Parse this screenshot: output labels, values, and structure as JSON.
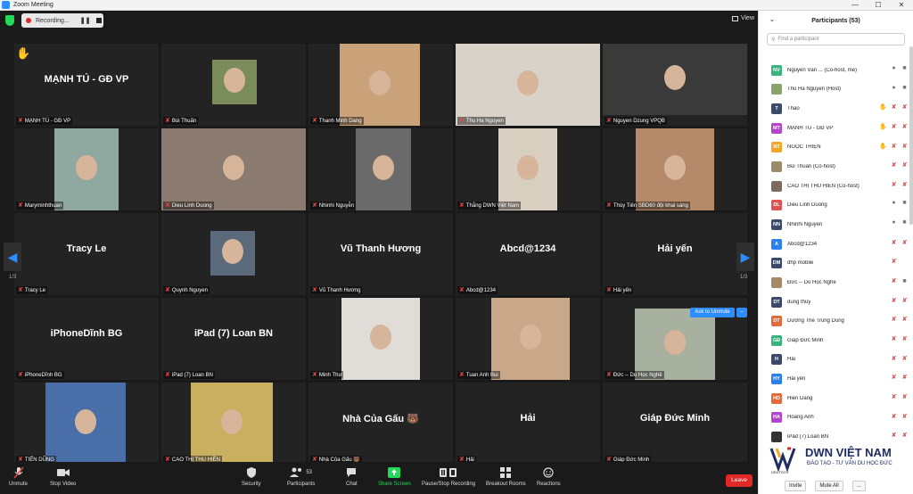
{
  "window": {
    "title": "Zoom Meeting",
    "controls": [
      "—",
      "☐",
      "✕"
    ]
  },
  "topbar": {
    "recording_label": "Recording...",
    "pause_icon": "❚❚",
    "view_label": "View"
  },
  "grid": {
    "page_left": "1/3",
    "page_right": "1/3",
    "tiles": [
      {
        "big": "MẠNH TÚ - GĐ VP",
        "label": "MẠNH TÚ - GĐ VP"
      },
      {
        "big": "",
        "label": "Bùi Thuấn"
      },
      {
        "big": "",
        "label": "Thanh Minh Dang"
      },
      {
        "big": "",
        "label": "Thu Ha Nguyen"
      },
      {
        "big": "",
        "label": "Nguyen Dzung VPQB"
      },
      {
        "big": "",
        "label": "Maryminhthuan"
      },
      {
        "big": "",
        "label": "Dieu Linh Duong"
      },
      {
        "big": "",
        "label": "Nhinhi Nguyễn"
      },
      {
        "big": "",
        "label": "Thắng DWN Việt Nam"
      },
      {
        "big": "",
        "label": "Thùy Tiên SBD60 đội khai sáng"
      },
      {
        "big": "Tracy Le",
        "label": "Tracy Le"
      },
      {
        "big": "",
        "label": "Quynh Nguyen"
      },
      {
        "big": "Vũ Thanh Hương",
        "label": "Vũ Thanh Hương"
      },
      {
        "big": "Abcd@1234",
        "label": "Abcd@1234"
      },
      {
        "big": "Hải yến",
        "label": "Hải yến"
      },
      {
        "big": "iPhoneDĩnh BG",
        "label": "iPhoneDĩnh BG"
      },
      {
        "big": "iPad (7) Loan BN",
        "label": "iPad (7) Loan BN"
      },
      {
        "big": "",
        "label": "Minh Thư"
      },
      {
        "big": "",
        "label": "Tuan Anh Bui"
      },
      {
        "big": "",
        "label": "Đức -- Du Học Nghề"
      },
      {
        "big": "",
        "label": "TIẾN DŨNG"
      },
      {
        "big": "",
        "label": "CAO THỊ THU HIỀN"
      },
      {
        "big": "Nhà Của Gấu 🐻",
        "label": "Nhà Của Gấu 🐻"
      },
      {
        "big": "Hải",
        "label": "Hải"
      },
      {
        "big": "Giáp Đức Minh",
        "label": "Giáp Đức Minh"
      }
    ],
    "ask_unmute": "Ask to Unmute",
    "more": "..."
  },
  "toolbar": {
    "unmute": "Unmute",
    "stop_video": "Stop Video",
    "security": "Security",
    "participants": "Participants",
    "participants_count": "53",
    "chat": "Chat",
    "share_screen": "Share Screen",
    "record": "Pause/Stop Recording",
    "breakout": "Breakout Rooms",
    "reactions": "Reactions",
    "leave": "Leave"
  },
  "panel": {
    "title": "Participants (53)",
    "search_placeholder": "Find a participant",
    "participants": [
      {
        "initials": "NV",
        "color": "#36b37e",
        "name": "Nguyễn Văn ...  (Co-host, me)",
        "hand": false,
        "mic": "on",
        "cam": "on"
      },
      {
        "initials": "",
        "color": "#8aa36b",
        "name": "Thu Ha Nguyen (Host)",
        "hand": false,
        "mic": "on",
        "cam": "on"
      },
      {
        "initials": "T",
        "color": "#3b4a6b",
        "name": "Thao",
        "hand": true,
        "mic": "off",
        "cam": "off"
      },
      {
        "initials": "MT",
        "color": "#b344cc",
        "name": "MẠNH TÚ - GĐ VP",
        "hand": true,
        "mic": "off",
        "cam": "off"
      },
      {
        "initials": "NT",
        "color": "#f5a623",
        "name": "NGỌC THIỆN",
        "hand": true,
        "mic": "off",
        "cam": "off"
      },
      {
        "initials": "",
        "color": "#9c8a6a",
        "name": "Bùi Thuấn (Co-host)",
        "hand": false,
        "mic": "off",
        "cam": "off"
      },
      {
        "initials": "",
        "color": "#7d6a5a",
        "name": "CAO THỊ THU HIỀN (Co-host)",
        "hand": false,
        "mic": "off",
        "cam": "off"
      },
      {
        "initials": "DL",
        "color": "#e05252",
        "name": "Dieu Linh Duong",
        "hand": false,
        "mic": "on",
        "cam": "on"
      },
      {
        "initials": "NN",
        "color": "#3b4a6b",
        "name": "Nhinhi Nguyễn",
        "hand": false,
        "mic": "on",
        "cam": "on"
      },
      {
        "initials": "A",
        "color": "#2d7ff0",
        "name": "Abcd@1234",
        "hand": false,
        "mic": "off",
        "cam": "off"
      },
      {
        "initials": "DM",
        "color": "#3b4a6b",
        "name": "dhp mobile",
        "hand": false,
        "mic": "off",
        "cam": ""
      },
      {
        "initials": "",
        "color": "#a58b65",
        "name": "Đức -- Du Học Nghề",
        "hand": false,
        "mic": "off",
        "cam": "on"
      },
      {
        "initials": "DT",
        "color": "#3b4a6b",
        "name": "dung thúy",
        "hand": false,
        "mic": "off",
        "cam": "off"
      },
      {
        "initials": "DT",
        "color": "#e06a3a",
        "name": "Dương Thế Trung Dũng",
        "hand": false,
        "mic": "off",
        "cam": "off"
      },
      {
        "initials": "GĐ",
        "color": "#36b37e",
        "name": "Giáp Đức Minh",
        "hand": false,
        "mic": "off",
        "cam": "off"
      },
      {
        "initials": "H",
        "color": "#3b4a6b",
        "name": "Hải",
        "hand": false,
        "mic": "off",
        "cam": "off"
      },
      {
        "initials": "HY",
        "color": "#2d7ff0",
        "name": "Hải yến",
        "hand": false,
        "mic": "off",
        "cam": "off"
      },
      {
        "initials": "HD",
        "color": "#e06a3a",
        "name": "Hien Dang",
        "hand": false,
        "mic": "off",
        "cam": "off"
      },
      {
        "initials": "HA",
        "color": "#b344cc",
        "name": "Hoàng Anh",
        "hand": false,
        "mic": "off",
        "cam": "off"
      },
      {
        "initials": "",
        "color": "#333333",
        "name": "iPad (7) Loan BN",
        "hand": false,
        "mic": "off",
        "cam": "off"
      }
    ],
    "invite": "Invite",
    "mute_all": "Mute All",
    "more": "..."
  },
  "brand": {
    "name": "DWN VIỆT NAM",
    "tagline": "ĐÀO TẠO - TƯ VẤN DU HỌC ĐỨC",
    "small": "DEUTSCH"
  }
}
